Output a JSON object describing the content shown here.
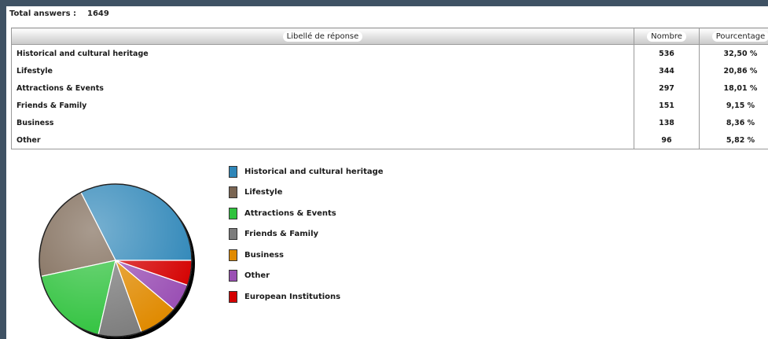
{
  "total": {
    "label": "Total answers :",
    "value": "1649"
  },
  "table": {
    "headers": [
      "Libellé de réponse",
      "Nombre",
      "Pourcentage"
    ],
    "rows": [
      {
        "label": "Historical and cultural heritage",
        "count": "536",
        "pct": "32,50 %"
      },
      {
        "label": "Lifestyle",
        "count": "344",
        "pct": "20,86 %"
      },
      {
        "label": "Attractions & Events",
        "count": "297",
        "pct": "18,01 %"
      },
      {
        "label": "Friends & Family",
        "count": "151",
        "pct": "9,15 %"
      },
      {
        "label": "Business",
        "count": "138",
        "pct": "8,36 %"
      },
      {
        "label": "Other",
        "count": "96",
        "pct": "5,82 %"
      }
    ]
  },
  "chart_data": {
    "type": "pie",
    "labels": [
      "Historical and cultural heritage",
      "Lifestyle",
      "Attractions & Events",
      "Friends & Family",
      "Business",
      "Other",
      "European Institutions"
    ],
    "values": [
      536,
      344,
      297,
      151,
      138,
      96,
      87
    ],
    "colors": [
      "#2e86b8",
      "#7a6552",
      "#2fc23d",
      "#7c7c7c",
      "#e08a00",
      "#9a4fb4",
      "#d40000"
    ],
    "legend": "right"
  }
}
